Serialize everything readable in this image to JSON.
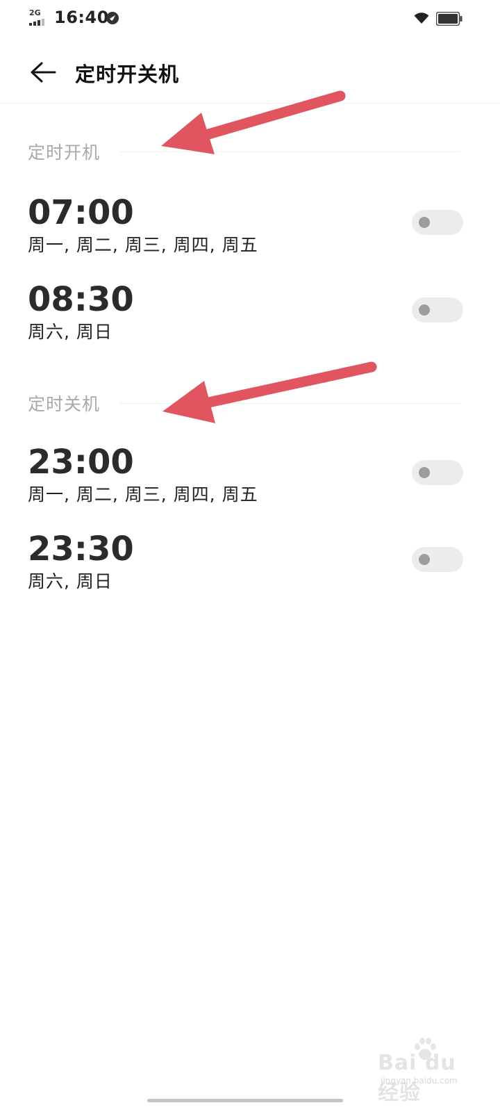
{
  "status_bar": {
    "network": "2G",
    "time": "16:40",
    "icons": [
      "signal-icon",
      "vpn-icon",
      "wifi-icon",
      "battery-icon"
    ]
  },
  "app_bar": {
    "title": "定时开关机",
    "back_icon": "arrow-left-icon"
  },
  "sections": [
    {
      "header": "定时开机",
      "items": [
        {
          "time": "07:00",
          "days": "周一, 周二, 周三, 周四, 周五",
          "enabled": false
        },
        {
          "time": "08:30",
          "days": "周六, 周日",
          "enabled": false
        }
      ]
    },
    {
      "header": "定时关机",
      "items": [
        {
          "time": "23:00",
          "days": "周一, 周二, 周三, 周四, 周五",
          "enabled": false
        },
        {
          "time": "23:30",
          "days": "周六, 周日",
          "enabled": false
        }
      ]
    }
  ],
  "annotations": {
    "arrow_color": "#e05560",
    "count": 2
  },
  "watermark": {
    "text": "Bai du 经验",
    "sub": "jingyan.baidu.com"
  },
  "colors": {
    "toggle_track_off": "#ececec",
    "toggle_knob_off": "#9d9d9d",
    "section_header": "#a9a9a9"
  }
}
